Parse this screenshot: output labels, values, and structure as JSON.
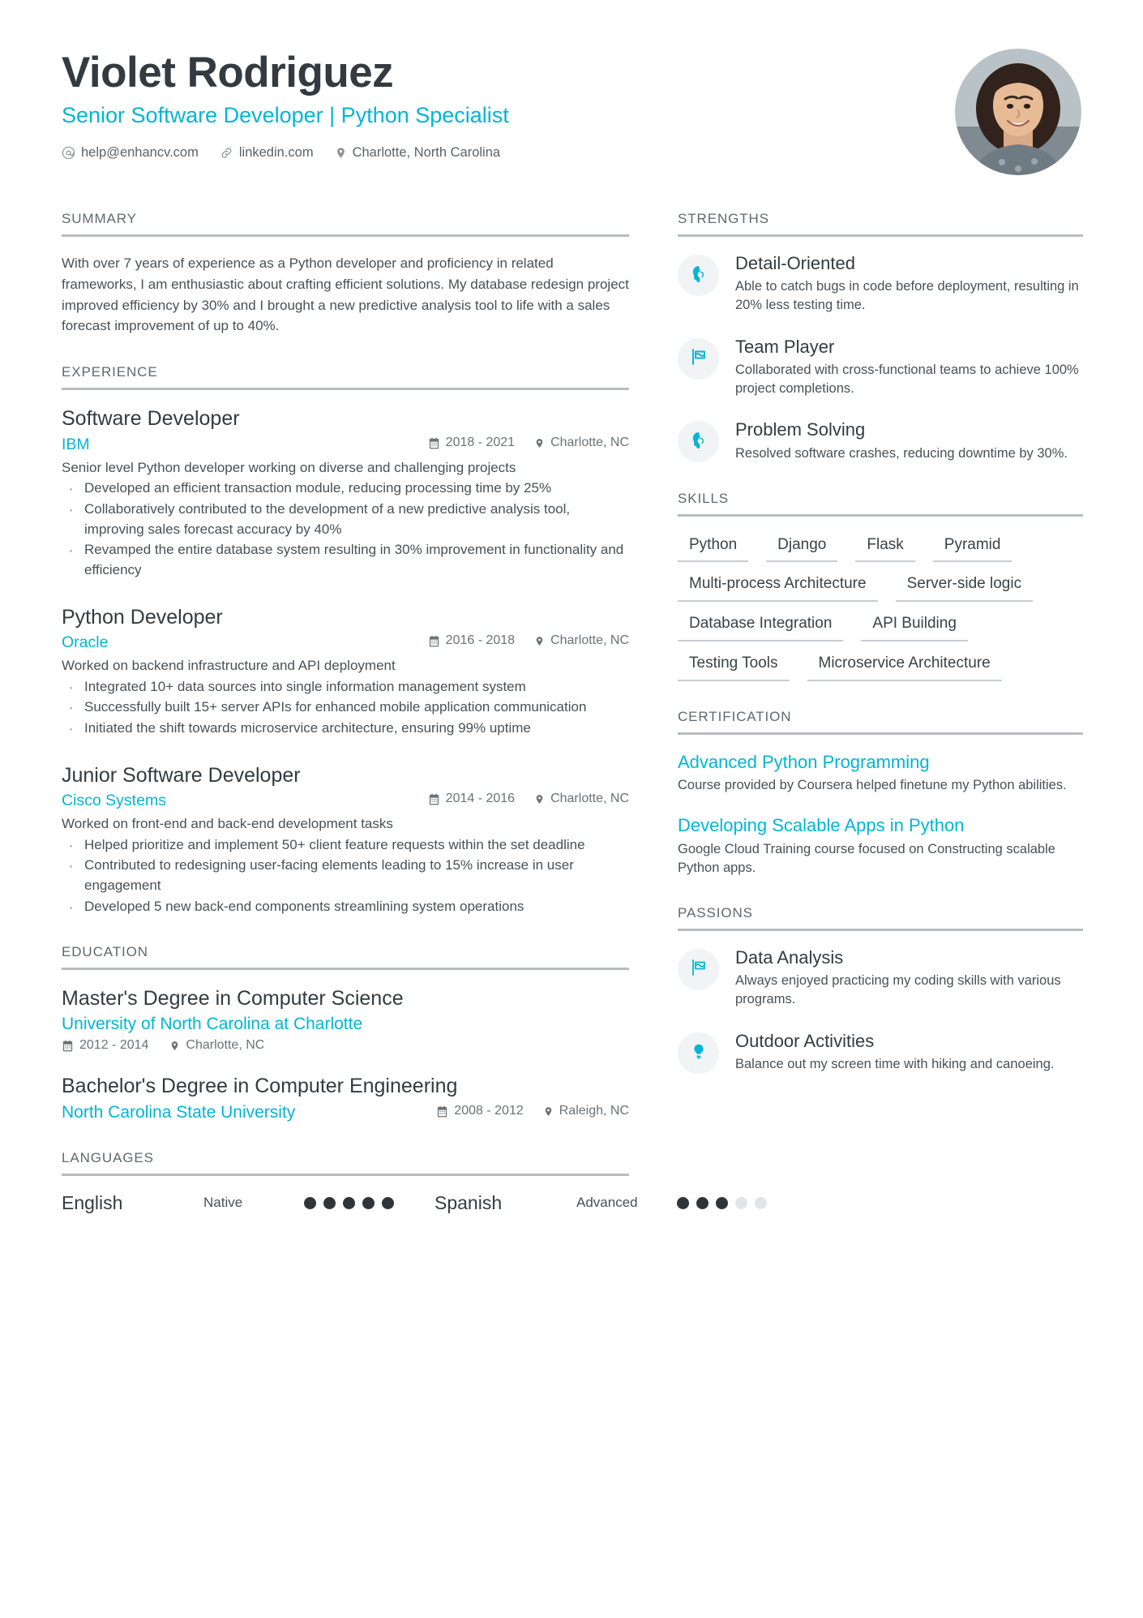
{
  "header": {
    "name": "Violet Rodriguez",
    "headline": "Senior Software Developer | Python Specialist",
    "contacts": [
      {
        "icon": "email-icon",
        "text": "help@enhancv.com"
      },
      {
        "icon": "link-icon",
        "text": "linkedin.com"
      },
      {
        "icon": "location-pin-icon",
        "text": "Charlotte, North Carolina"
      }
    ]
  },
  "summary": {
    "title": "SUMMARY",
    "text": "With over 7 years of experience as a Python developer and proficiency in related frameworks, I am enthusiastic about crafting efficient solutions. My database redesign project improved efficiency by 30% and I brought a new predictive analysis tool to life with a sales forecast improvement of up to 40%."
  },
  "experience": {
    "title": "EXPERIENCE",
    "jobs": [
      {
        "title": "Software Developer",
        "company": "IBM",
        "dates": "2018 - 2021",
        "location": "Charlotte, NC",
        "description": "Senior level Python developer working on diverse and challenging projects",
        "bullets": [
          "Developed an efficient transaction module, reducing processing time by 25%",
          "Collaboratively contributed to the development of a new predictive analysis tool, improving sales forecast accuracy by 40%",
          "Revamped the entire database system resulting in 30% improvement in functionality and efficiency"
        ]
      },
      {
        "title": "Python Developer",
        "company": "Oracle",
        "dates": "2016 - 2018",
        "location": "Charlotte, NC",
        "description": "Worked on backend infrastructure and API deployment",
        "bullets": [
          "Integrated 10+ data sources into single information management system",
          "Successfully built 15+ server APIs for enhanced mobile application communication",
          "Initiated the shift towards microservice architecture, ensuring 99% uptime"
        ]
      },
      {
        "title": "Junior Software Developer",
        "company": "Cisco Systems",
        "dates": "2014 - 2016",
        "location": "Charlotte, NC",
        "description": "Worked on front-end and back-end development tasks",
        "bullets": [
          "Helped prioritize and implement 50+ client feature requests within the set deadline",
          "Contributed to redesigning user-facing elements leading to 15% increase in user engagement",
          "Developed 5 new back-end components streamlining system operations"
        ]
      }
    ]
  },
  "education": {
    "title": "EDUCATION",
    "entries": [
      {
        "degree": "Master's Degree in Computer Science",
        "school": "University of North Carolina at Charlotte",
        "dates": "2012 - 2014",
        "location": "Charlotte, NC",
        "meta_inline": false
      },
      {
        "degree": "Bachelor's Degree in Computer Engineering",
        "school": "North Carolina State University",
        "dates": "2008 - 2012",
        "location": "Raleigh, NC",
        "meta_inline": true
      }
    ]
  },
  "languages": {
    "title": "LANGUAGES",
    "items": [
      {
        "name": "English",
        "level": "Native",
        "filled": 5,
        "total": 5
      },
      {
        "name": "Spanish",
        "level": "Advanced",
        "filled": 3,
        "total": 5
      }
    ]
  },
  "strengths": {
    "title": "STRENGTHS",
    "items": [
      {
        "icon": "head-lightbulb-icon",
        "title": "Detail-Oriented",
        "desc": "Able to catch bugs in code before deployment, resulting in 20% less testing time."
      },
      {
        "icon": "flag-icon",
        "title": "Team Player",
        "desc": "Collaborated with cross-functional teams to achieve 100% project completions."
      },
      {
        "icon": "head-lightbulb-icon",
        "title": "Problem Solving",
        "desc": "Resolved software crashes, reducing downtime by 30%."
      }
    ]
  },
  "skills": {
    "title": "SKILLS",
    "items": [
      "Python",
      "Django",
      "Flask",
      "Pyramid",
      "Multi-process Architecture",
      "Server-side logic",
      "Database Integration",
      "API Building",
      "Testing Tools",
      "Microservice Architecture"
    ]
  },
  "certification": {
    "title": "CERTIFICATION",
    "items": [
      {
        "title": "Advanced Python Programming",
        "desc": "Course provided by Coursera helped finetune my Python abilities."
      },
      {
        "title": "Developing Scalable Apps in Python",
        "desc": "Google Cloud Training course focused on Constructing scalable Python apps."
      }
    ]
  },
  "passions": {
    "title": "PASSIONS",
    "items": [
      {
        "icon": "flag-outline-icon",
        "title": "Data Analysis",
        "desc": "Always enjoyed practicing my coding skills with various programs."
      },
      {
        "icon": "lightbulb-icon",
        "title": "Outdoor Activities",
        "desc": "Balance out my screen time with hiking and canoeing."
      }
    ]
  },
  "colors": {
    "accent": "#00b6d4",
    "heading": "#333b41",
    "body": "#495056",
    "rule": "#b9bcbe",
    "badge_bg": "#f2f3f4"
  }
}
